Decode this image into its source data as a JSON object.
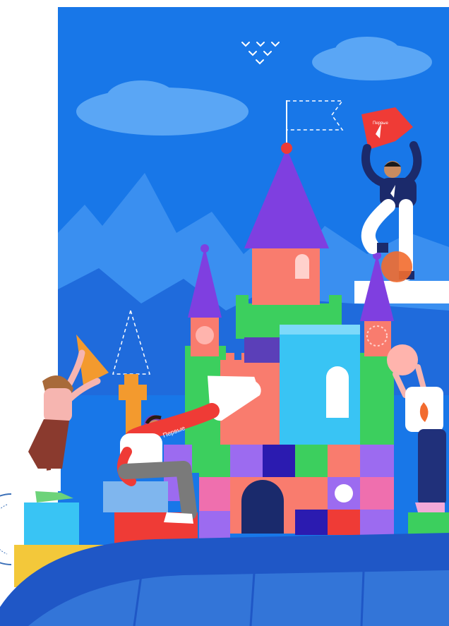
{
  "illustration": {
    "flag_text": "Первые",
    "sleeve_text": "Первые"
  },
  "colors": {
    "sky": "#1877e8",
    "mountains": "#3a8ff0",
    "ground": "#1f57c6",
    "brand_red": "#ef3b36",
    "purple_roof": "#7f3fe0",
    "salmon": "#f97c6e",
    "green": "#3ccf5e",
    "cyan": "#39c4f4",
    "yellow": "#f3c83a",
    "navy": "#20307a"
  }
}
